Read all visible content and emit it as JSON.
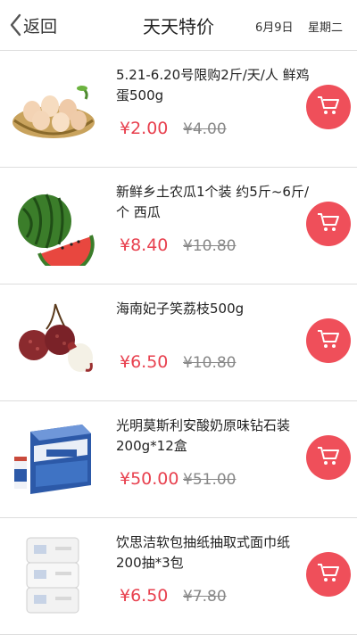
{
  "header": {
    "back_label": "返回",
    "title": "天天特价",
    "date": "6月9日",
    "weekday": "星期二"
  },
  "products": [
    {
      "name": "5.21-6.20号限购2斤/天/人 鲜鸡蛋500g",
      "price": "¥2.00",
      "original_price": "¥4.00",
      "image_icon": "eggs-basket"
    },
    {
      "name": "新鲜乡土农瓜1个装 约5斤~6斤/个 西瓜",
      "price": "¥8.40",
      "original_price": "¥10.80",
      "image_icon": "watermelon"
    },
    {
      "name": "海南妃子笑荔枝500g",
      "price": "¥6.50",
      "original_price": "¥10.80",
      "image_icon": "lychee"
    },
    {
      "name": "光明莫斯利安酸奶原味钻石装200g*12盒",
      "price": "¥50.00",
      "original_price": "¥51.00",
      "image_icon": "yogurt-box"
    },
    {
      "name": "饮思洁软包抽纸抽取式面巾纸200抽*3包",
      "price": "¥6.50",
      "original_price": "¥7.80",
      "image_icon": "tissue-pack"
    }
  ],
  "colors": {
    "accent": "#ef4f5a",
    "price": "#e8414f",
    "divider": "#dddddd"
  }
}
